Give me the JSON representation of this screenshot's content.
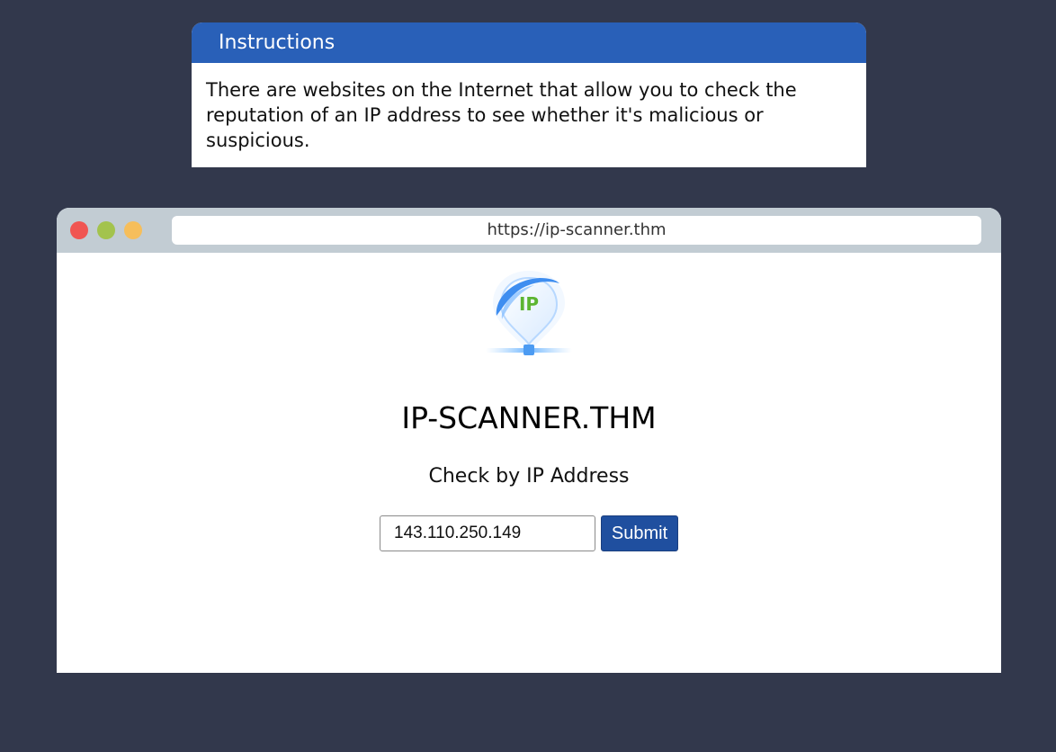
{
  "instructions": {
    "title": "Instructions",
    "body": "There are websites on the Internet that allow you to check the reputation of an IP address to see whether it's malicious or suspicious."
  },
  "browser": {
    "url": "https://ip-scanner.thm",
    "window_controls": [
      "close",
      "minimize",
      "maximize"
    ]
  },
  "site": {
    "logo_text": "IP",
    "title": "IP-SCANNER.THM",
    "subtitle": "Check by IP Address",
    "ip_input_value": "143.110.250.149",
    "submit_label": "Submit"
  },
  "colors": {
    "background": "#32384c",
    "instructions_header": "#2960b8",
    "browser_bar": "#c2ccd3",
    "close_dot": "#f05552",
    "minimize_dot": "#a3c34d",
    "maximize_dot": "#f6be5b",
    "submit_button": "#1f4f9f",
    "logo_text": "#5cb531"
  },
  "icons": {
    "logo": "ip-location-pin-icon"
  }
}
